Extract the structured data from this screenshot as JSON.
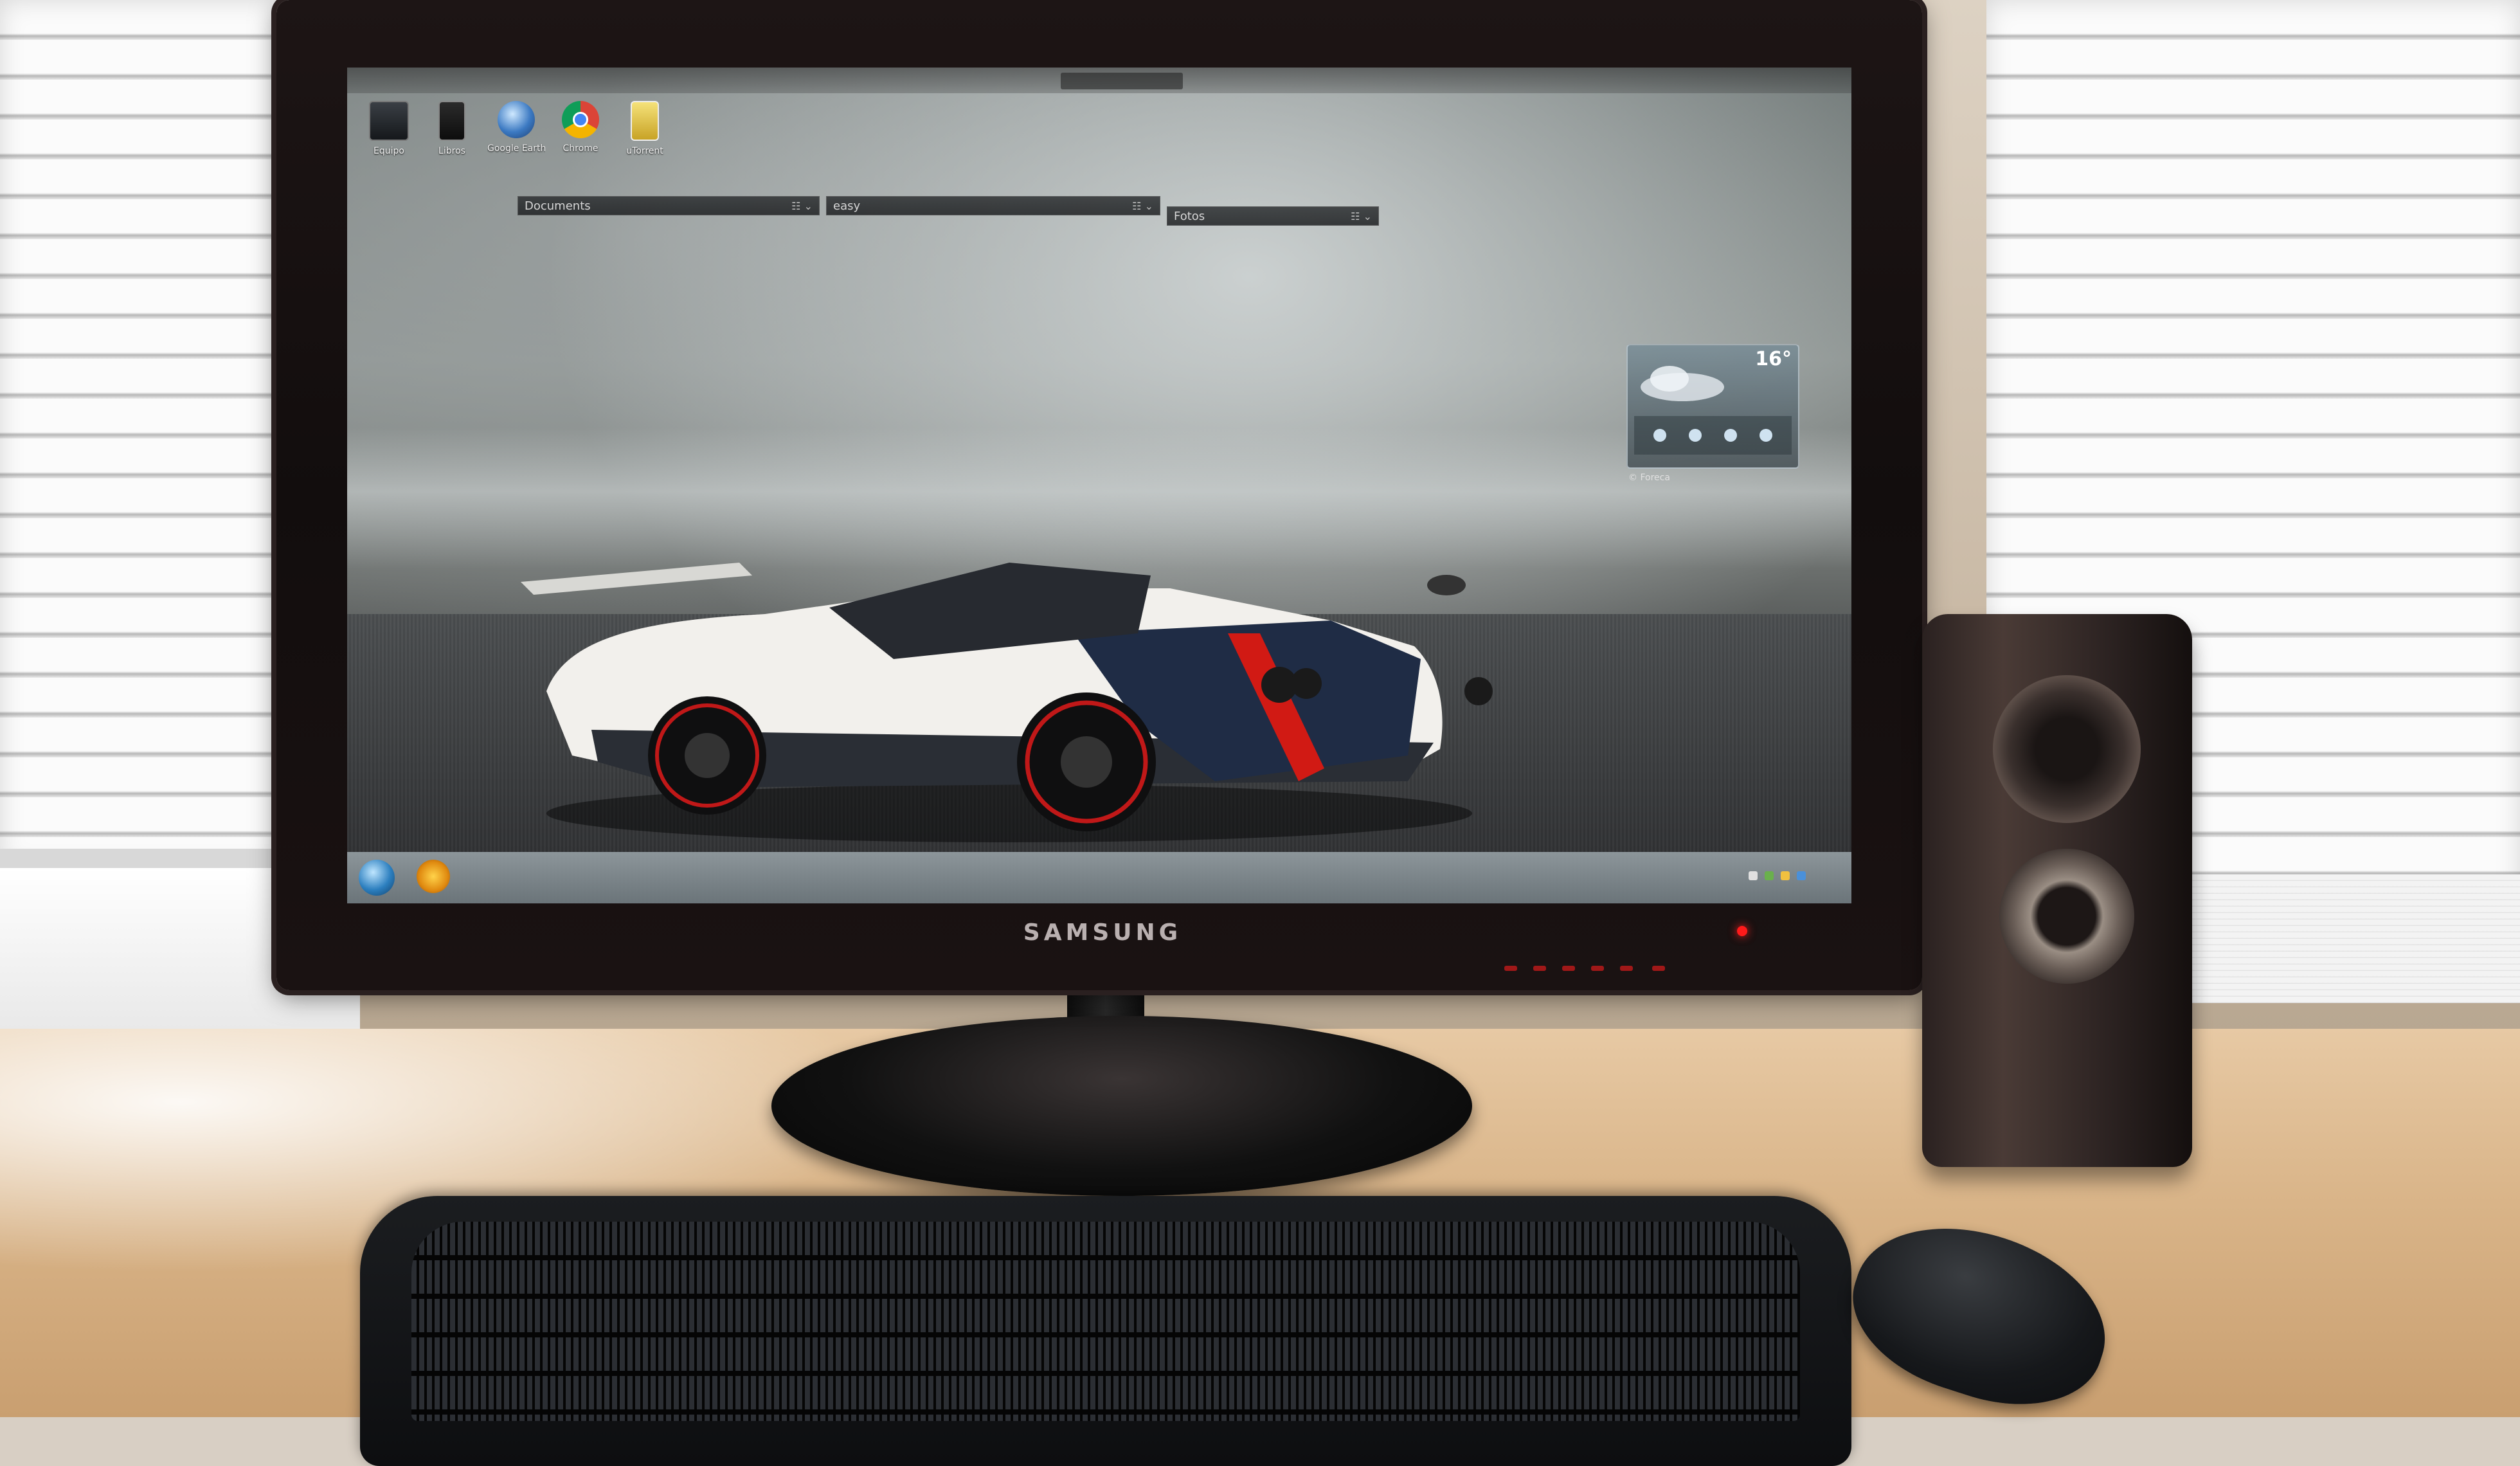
{
  "monitor": {
    "brand": "SAMSUNG"
  },
  "desktop": {
    "icons": [
      {
        "label": "Equipo",
        "icon": "computer-icon"
      },
      {
        "label": "Libros",
        "icon": "library-icon"
      },
      {
        "label": "Google Earth",
        "icon": "globe-icon"
      },
      {
        "label": "Chrome",
        "icon": "chrome-icon"
      },
      {
        "label": "uTorrent",
        "icon": "document-icon"
      }
    ],
    "fences": [
      {
        "label": "Documents"
      },
      {
        "label": "easy"
      },
      {
        "label": "Fotos"
      }
    ],
    "weather": {
      "temperature": "16°",
      "footer": "© Foreca"
    }
  },
  "colors": {
    "power_led": "#ff1a1a",
    "car_body": "#f2f0ec",
    "car_stripe": "#d11a14"
  }
}
